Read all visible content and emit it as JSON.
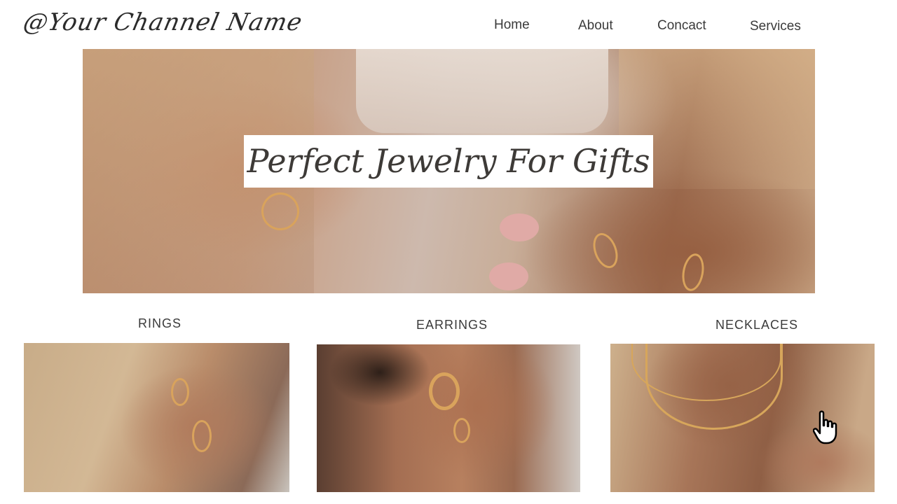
{
  "header": {
    "brand": "@Your Channel Name",
    "nav": [
      "Home",
      "About",
      "Concact",
      "Services"
    ]
  },
  "hero": {
    "title": "Perfect Jewelry For Gifts"
  },
  "categories": [
    {
      "label": "RINGS"
    },
    {
      "label": "EARRINGS"
    },
    {
      "label": "NECKLACES"
    }
  ],
  "colors": {
    "background": "#ffffff",
    "text": "#3b3b3b",
    "gold_accent": "#d9a35c"
  },
  "icons": {
    "cursor": "hand-pointer-icon"
  }
}
